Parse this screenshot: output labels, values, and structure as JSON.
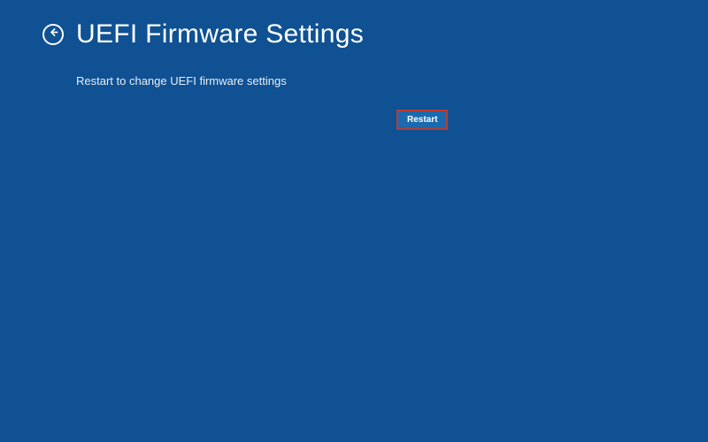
{
  "header": {
    "title": "UEFI Firmware Settings"
  },
  "main": {
    "description": "Restart to change UEFI firmware settings",
    "restart_label": "Restart"
  }
}
